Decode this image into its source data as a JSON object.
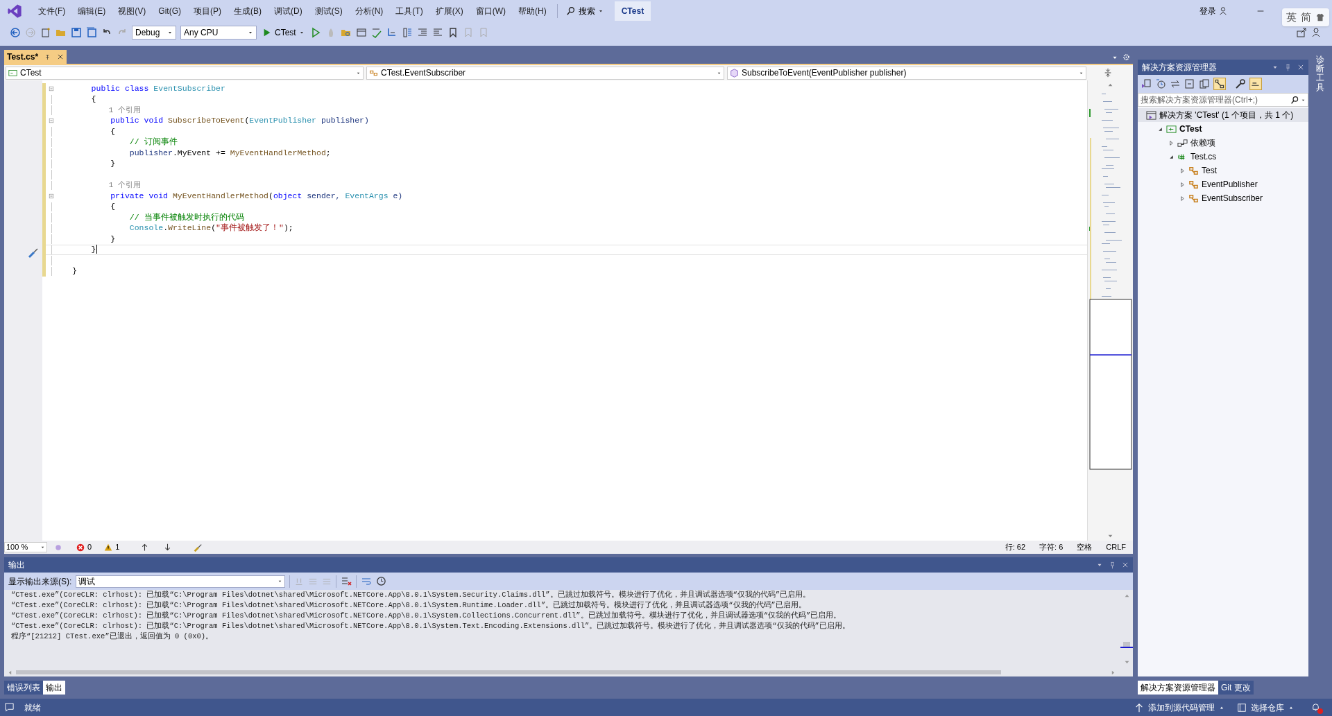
{
  "menu": [
    "文件(F)",
    "编辑(E)",
    "视图(V)",
    "Git(G)",
    "项目(P)",
    "生成(B)",
    "调试(D)",
    "测试(S)",
    "分析(N)",
    "工具(T)",
    "扩展(X)",
    "窗口(W)",
    "帮助(H)"
  ],
  "search_button": "搜索",
  "solution_badge": "CTest",
  "login": "登录",
  "ime": [
    "英",
    "简"
  ],
  "toolbar": {
    "config": "Debug",
    "platform": "Any CPU",
    "run": "CTest"
  },
  "doc_tabs": [
    {
      "label": "Test.cs*",
      "selected": true
    }
  ],
  "nav": [
    "CTest",
    "CTest.EventSubscriber",
    "SubscribeToEvent(EventPublisher publisher)"
  ],
  "code_lines": [
    {
      "fold": true,
      "current": false,
      "tokens": [
        {
          "text": "    public class ",
          "kind": "kw"
        },
        {
          "text": "EventSubscriber",
          "kind": "type"
        }
      ]
    },
    {
      "fold": false,
      "current": false,
      "tokens": [
        {
          "text": "    {",
          "kind": "plain"
        }
      ]
    },
    {
      "fold": false,
      "current": false,
      "tokens": [
        {
          "text": "        1 个引用",
          "kind": "lens"
        }
      ]
    },
    {
      "fold": true,
      "current": false,
      "tokens": [
        {
          "text": "        public void ",
          "kind": "kw"
        },
        {
          "text": "SubscribeToEvent",
          "kind": "method"
        },
        {
          "text": "(",
          "kind": "plain"
        },
        {
          "text": "EventPublisher",
          "kind": "type"
        },
        {
          "text": " publisher)",
          "kind": "param"
        }
      ]
    },
    {
      "fold": false,
      "current": false,
      "tokens": [
        {
          "text": "        {",
          "kind": "plain"
        }
      ]
    },
    {
      "fold": false,
      "current": false,
      "tokens": [
        {
          "text": "            // 订阅事件",
          "kind": "comment"
        }
      ]
    },
    {
      "fold": false,
      "current": false,
      "tokens": [
        {
          "text": "            publisher",
          "kind": "param"
        },
        {
          "text": ".MyEvent += ",
          "kind": "plain"
        },
        {
          "text": "MyEventHandlerMethod",
          "kind": "method"
        },
        {
          "text": ";",
          "kind": "plain"
        }
      ]
    },
    {
      "fold": false,
      "current": false,
      "tokens": [
        {
          "text": "        }",
          "kind": "plain"
        }
      ]
    },
    {
      "fold": false,
      "current": false
    },
    {
      "fold": false,
      "current": false,
      "tokens": [
        {
          "text": "        1 个引用",
          "kind": "lens"
        }
      ]
    },
    {
      "fold": true,
      "current": false,
      "tokens": [
        {
          "text": "        private void ",
          "kind": "kw"
        },
        {
          "text": "MyEventHandlerMethod",
          "kind": "method"
        },
        {
          "text": "(",
          "kind": "plain"
        },
        {
          "text": "object",
          "kind": "kw"
        },
        {
          "text": " sender, ",
          "kind": "param"
        },
        {
          "text": "EventArgs",
          "kind": "type"
        },
        {
          "text": " e)",
          "kind": "param"
        }
      ]
    },
    {
      "fold": false,
      "current": false,
      "tokens": [
        {
          "text": "        {",
          "kind": "plain"
        }
      ]
    },
    {
      "fold": false,
      "current": false,
      "tokens": [
        {
          "text": "            // 当事件被触发时执行的代码",
          "kind": "comment"
        }
      ]
    },
    {
      "fold": false,
      "current": false,
      "tokens": [
        {
          "text": "            Console",
          "kind": "type"
        },
        {
          "text": ".",
          "kind": "plain"
        },
        {
          "text": "WriteLine",
          "kind": "method"
        },
        {
          "text": "(",
          "kind": "plain"
        },
        {
          "text": "\"事件被触发了！\"",
          "kind": "string"
        },
        {
          "text": ");",
          "kind": "plain"
        }
      ]
    },
    {
      "fold": false,
      "current": false,
      "tokens": [
        {
          "text": "        }",
          "kind": "plain"
        }
      ]
    },
    {
      "fold": false,
      "current": true,
      "tokens": [
        {
          "text": "    }",
          "kind": "plain"
        }
      ]
    },
    {
      "fold": false,
      "current": false
    },
    {
      "fold": false,
      "current": false,
      "tokens": [
        {
          "text": "}",
          "kind": "plain"
        }
      ]
    }
  ],
  "editor_status": {
    "zoom": "100 %",
    "errors": "0",
    "warnings": "1",
    "line": "行: 62",
    "col": "字符: 6",
    "spaces": "空格",
    "eol": "CRLF"
  },
  "output": {
    "title": "输出",
    "source_label": "显示输出来源(S):",
    "source": "调试",
    "lines": [
      "“CTest.exe”(CoreCLR: clrhost): 已加载“C:\\Program Files\\dotnet\\shared\\Microsoft.NETCore.App\\8.0.1\\System.Security.Claims.dll”。已跳过加载符号。模块进行了优化，并且调试器选项“仅我的代码”已启用。",
      "“CTest.exe”(CoreCLR: clrhost): 已加载“C:\\Program Files\\dotnet\\shared\\Microsoft.NETCore.App\\8.0.1\\System.Runtime.Loader.dll”。已跳过加载符号。模块进行了优化，并且调试器选项“仅我的代码”已启用。",
      "“CTest.exe”(CoreCLR: clrhost): 已加载“C:\\Program Files\\dotnet\\shared\\Microsoft.NETCore.App\\8.0.1\\System.Collections.Concurrent.dll”。已跳过加载符号。模块进行了优化，并且调试器选项“仅我的代码”已启用。",
      "“CTest.exe”(CoreCLR: clrhost): 已加载“C:\\Program Files\\dotnet\\shared\\Microsoft.NETCore.App\\8.0.1\\System.Text.Encoding.Extensions.dll”。已跳过加载符号。模块进行了优化，并且调试器选项“仅我的代码”已启用。",
      "程序“[21212] CTest.exe”已退出，返回值为 0 (0x0)。"
    ]
  },
  "bottom_tabs": [
    {
      "label": "错误列表",
      "selected": false
    },
    {
      "label": "输出",
      "selected": true
    }
  ],
  "solution_explorer": {
    "title": "解决方案资源管理器",
    "search_placeholder": "搜索解决方案资源管理器(Ctrl+;)",
    "tree": [
      {
        "label": "解决方案 'CTest' (1 个项目，共 1 个)",
        "kind": "solution",
        "selected": true,
        "children": [
          {
            "label": "CTest",
            "kind": "project",
            "selected": false,
            "expanded": true,
            "children": [
              {
                "label": "依赖项",
                "kind": "deps",
                "selected": false,
                "expanded": false
              },
              {
                "label": "Test.cs",
                "kind": "file",
                "selected": false,
                "expanded": true,
                "children": [
                  {
                    "label": "Test",
                    "kind": "class",
                    "selected": false,
                    "expanded": false
                  },
                  {
                    "label": "EventPublisher",
                    "kind": "class",
                    "selected": false,
                    "expanded": false
                  },
                  {
                    "label": "EventSubscriber",
                    "kind": "class",
                    "selected": false,
                    "expanded": false
                  }
                ]
              }
            ]
          }
        ]
      }
    ]
  },
  "side_tabs": [
    {
      "label": "解决方案资源管理器",
      "selected": true
    },
    {
      "label": "Git 更改",
      "selected": false
    }
  ],
  "right_strip": "诊断工具",
  "status": {
    "text": "就绪",
    "source_control": "添加到源代码管理",
    "repo": "选择仓库"
  }
}
